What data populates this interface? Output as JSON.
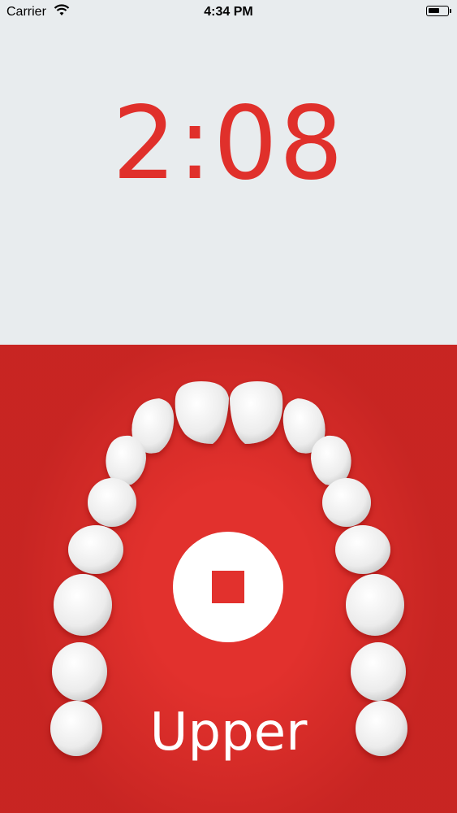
{
  "status_bar": {
    "carrier": "Carrier",
    "time": "4:34 PM",
    "battery_level": 0.6
  },
  "timer": {
    "display": "2:08"
  },
  "brushing": {
    "section_label": "Upper",
    "stop_icon": "stop-icon"
  },
  "colors": {
    "accent": "#e2312d",
    "timer_text": "#e0302b",
    "top_background": "#e8ecee",
    "tooth": "#f2f2f2"
  }
}
